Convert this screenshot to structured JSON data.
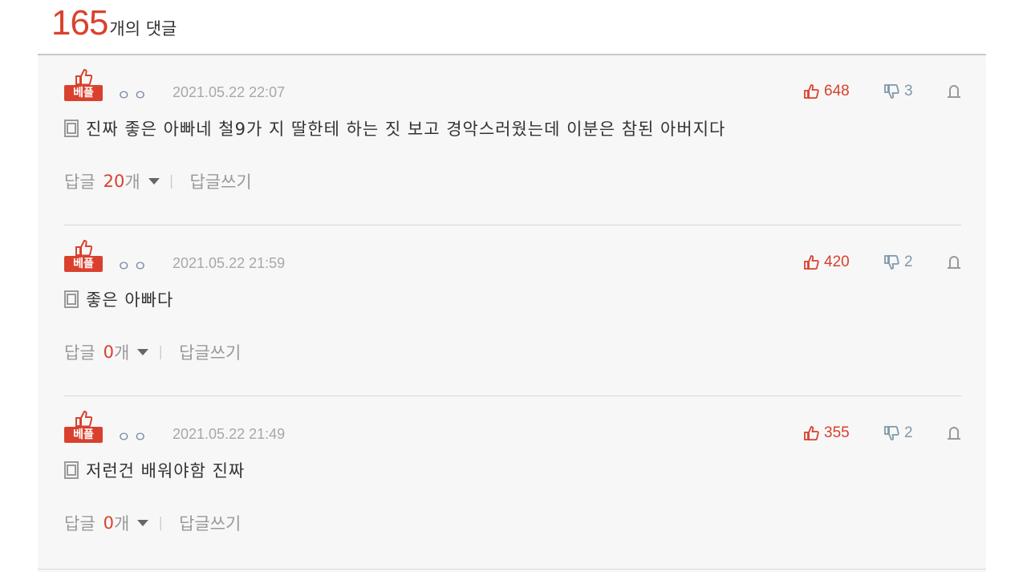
{
  "header": {
    "count": "165",
    "label": "개의 댓글"
  },
  "colors": {
    "accent": "#d9412e",
    "panel_bg": "#f7f7f7"
  },
  "comments": [
    {
      "badge": "베플",
      "author": "ㅇㅇ",
      "date": "2021.05.22 22:07",
      "likes": "648",
      "dislikes": "3",
      "text": "진짜 좋은 아빠네 철9가 지 딸한테 하는 짓 보고 경악스러웠는데 이분은 참된 아버지다",
      "reply_label": "답글",
      "reply_count": "20",
      "reply_unit": "개",
      "write_reply": "답글쓰기"
    },
    {
      "badge": "베플",
      "author": "ㅇㅇ",
      "date": "2021.05.22 21:59",
      "likes": "420",
      "dislikes": "2",
      "text": "좋은 아빠다",
      "reply_label": "답글",
      "reply_count": "0",
      "reply_unit": "개",
      "write_reply": "답글쓰기"
    },
    {
      "badge": "베플",
      "author": "ㅇㅇ",
      "date": "2021.05.22 21:49",
      "likes": "355",
      "dislikes": "2",
      "text": "저런건 배워야함 진짜",
      "reply_label": "답글",
      "reply_count": "0",
      "reply_unit": "개",
      "write_reply": "답글쓰기"
    }
  ],
  "icons": [
    "thumbs-up-icon",
    "thumbs-down-icon",
    "report-icon",
    "document-icon",
    "caret-down-icon"
  ]
}
